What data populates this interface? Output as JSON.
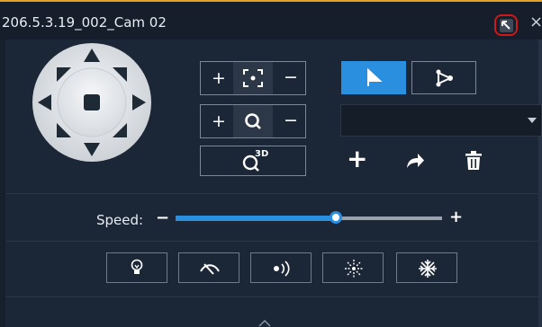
{
  "window": {
    "title": "206.5.3.19_002_Cam 02",
    "restore_icon": "restore-arrow-icon",
    "close_label": "×"
  },
  "ptz": {
    "joystick_icons": [
      "arrow-up-icon",
      "arrow-down-icon",
      "arrow-left-icon",
      "arrow-right-icon",
      "arrow-up-left-icon",
      "arrow-up-right-icon",
      "arrow-down-left-icon",
      "arrow-down-right-icon",
      "stop-icon"
    ],
    "focus": {
      "plus": "+",
      "minus": "−",
      "icon": "focus-icon"
    },
    "zoom": {
      "plus": "+",
      "minus": "−",
      "icon": "zoom-icon"
    },
    "ptz3d": {
      "label": "3D",
      "icon": "3d-position-icon"
    }
  },
  "preset": {
    "preset_tab_icon": "preset-flag-icon",
    "patrol_tab_icon": "patrol-route-icon",
    "selected_value": "",
    "add_label": "+",
    "goto_icon": "goto-arrow-icon",
    "delete_icon": "trash-icon"
  },
  "speed": {
    "label": "Speed:",
    "minus": "−",
    "plus": "+",
    "value_fraction": 0.6
  },
  "functions": [
    {
      "name": "light-button",
      "icon": "light-bulb-icon"
    },
    {
      "name": "wiper-button",
      "icon": "wiper-icon"
    },
    {
      "name": "ir-button",
      "icon": "ir-signal-icon"
    },
    {
      "name": "defog-button",
      "icon": "defog-icon"
    },
    {
      "name": "snow-button",
      "icon": "snowflake-icon"
    }
  ],
  "colors": {
    "accent": "#2b8fe0",
    "titlebar_border": "#e3a126",
    "highlight": "#d01818"
  }
}
